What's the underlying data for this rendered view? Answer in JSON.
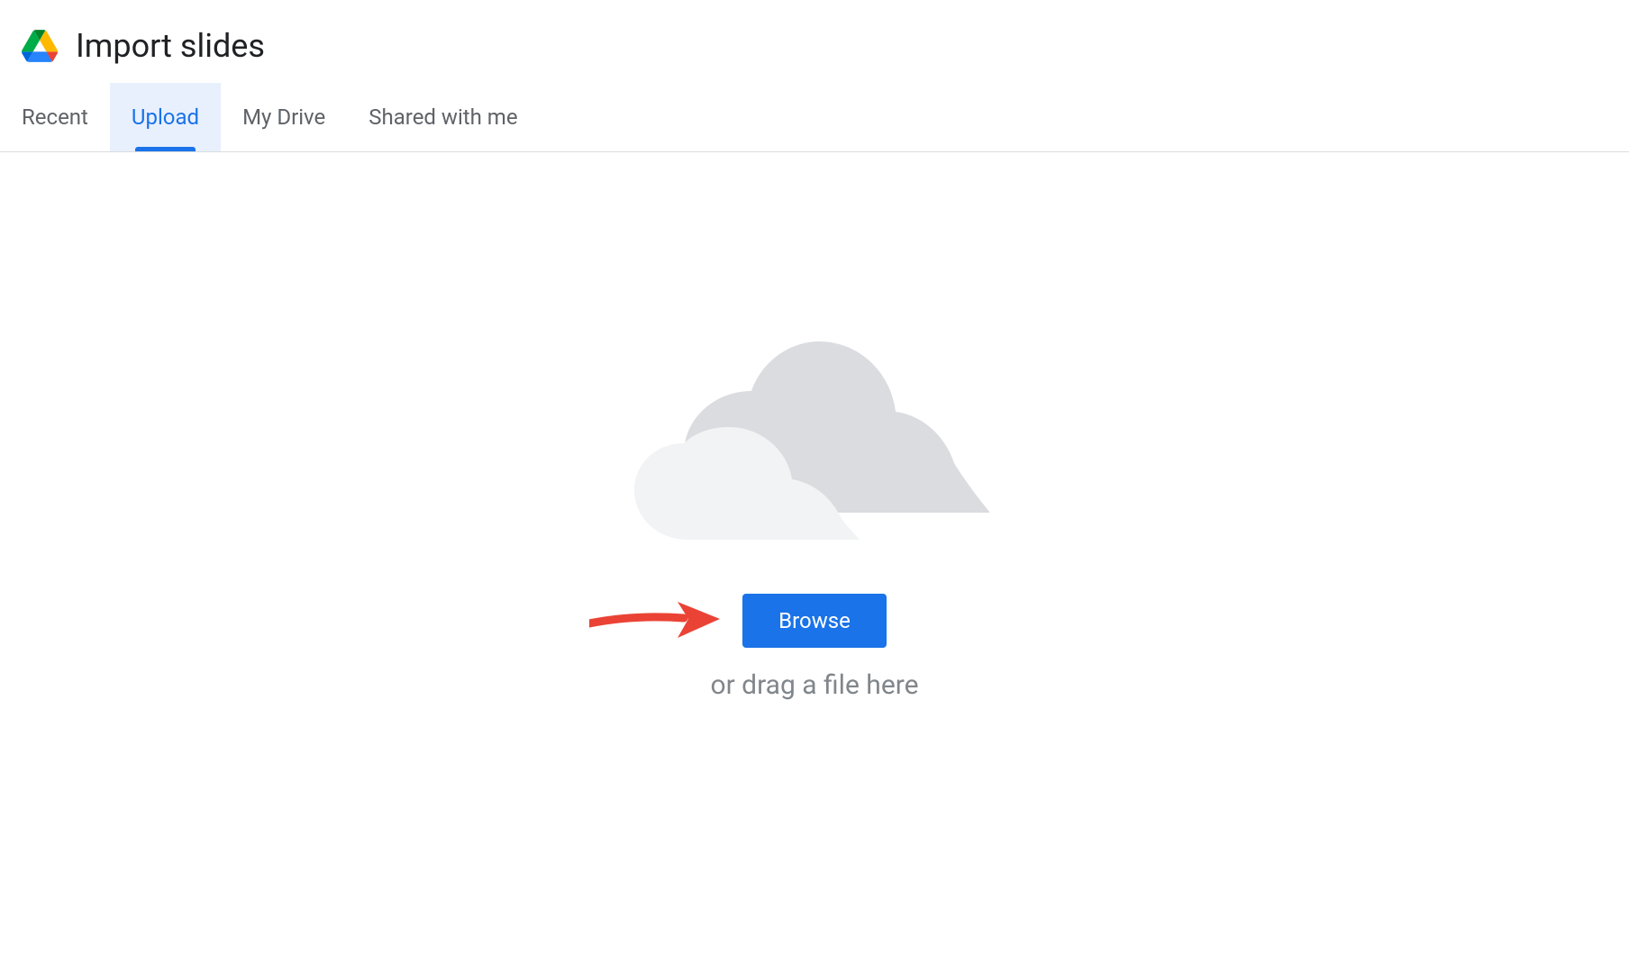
{
  "header": {
    "title": "Import slides"
  },
  "tabs": [
    {
      "label": "Recent",
      "active": false
    },
    {
      "label": "Upload",
      "active": true
    },
    {
      "label": "My Drive",
      "active": false
    },
    {
      "label": "Shared with me",
      "active": false
    }
  ],
  "upload": {
    "browse_label": "Browse",
    "drag_hint": "or drag a file here"
  },
  "colors": {
    "accent": "#1a73e8",
    "cloud_back": "#dadce0",
    "cloud_front": "#f1f3f4",
    "arrow": "#ea4335"
  }
}
